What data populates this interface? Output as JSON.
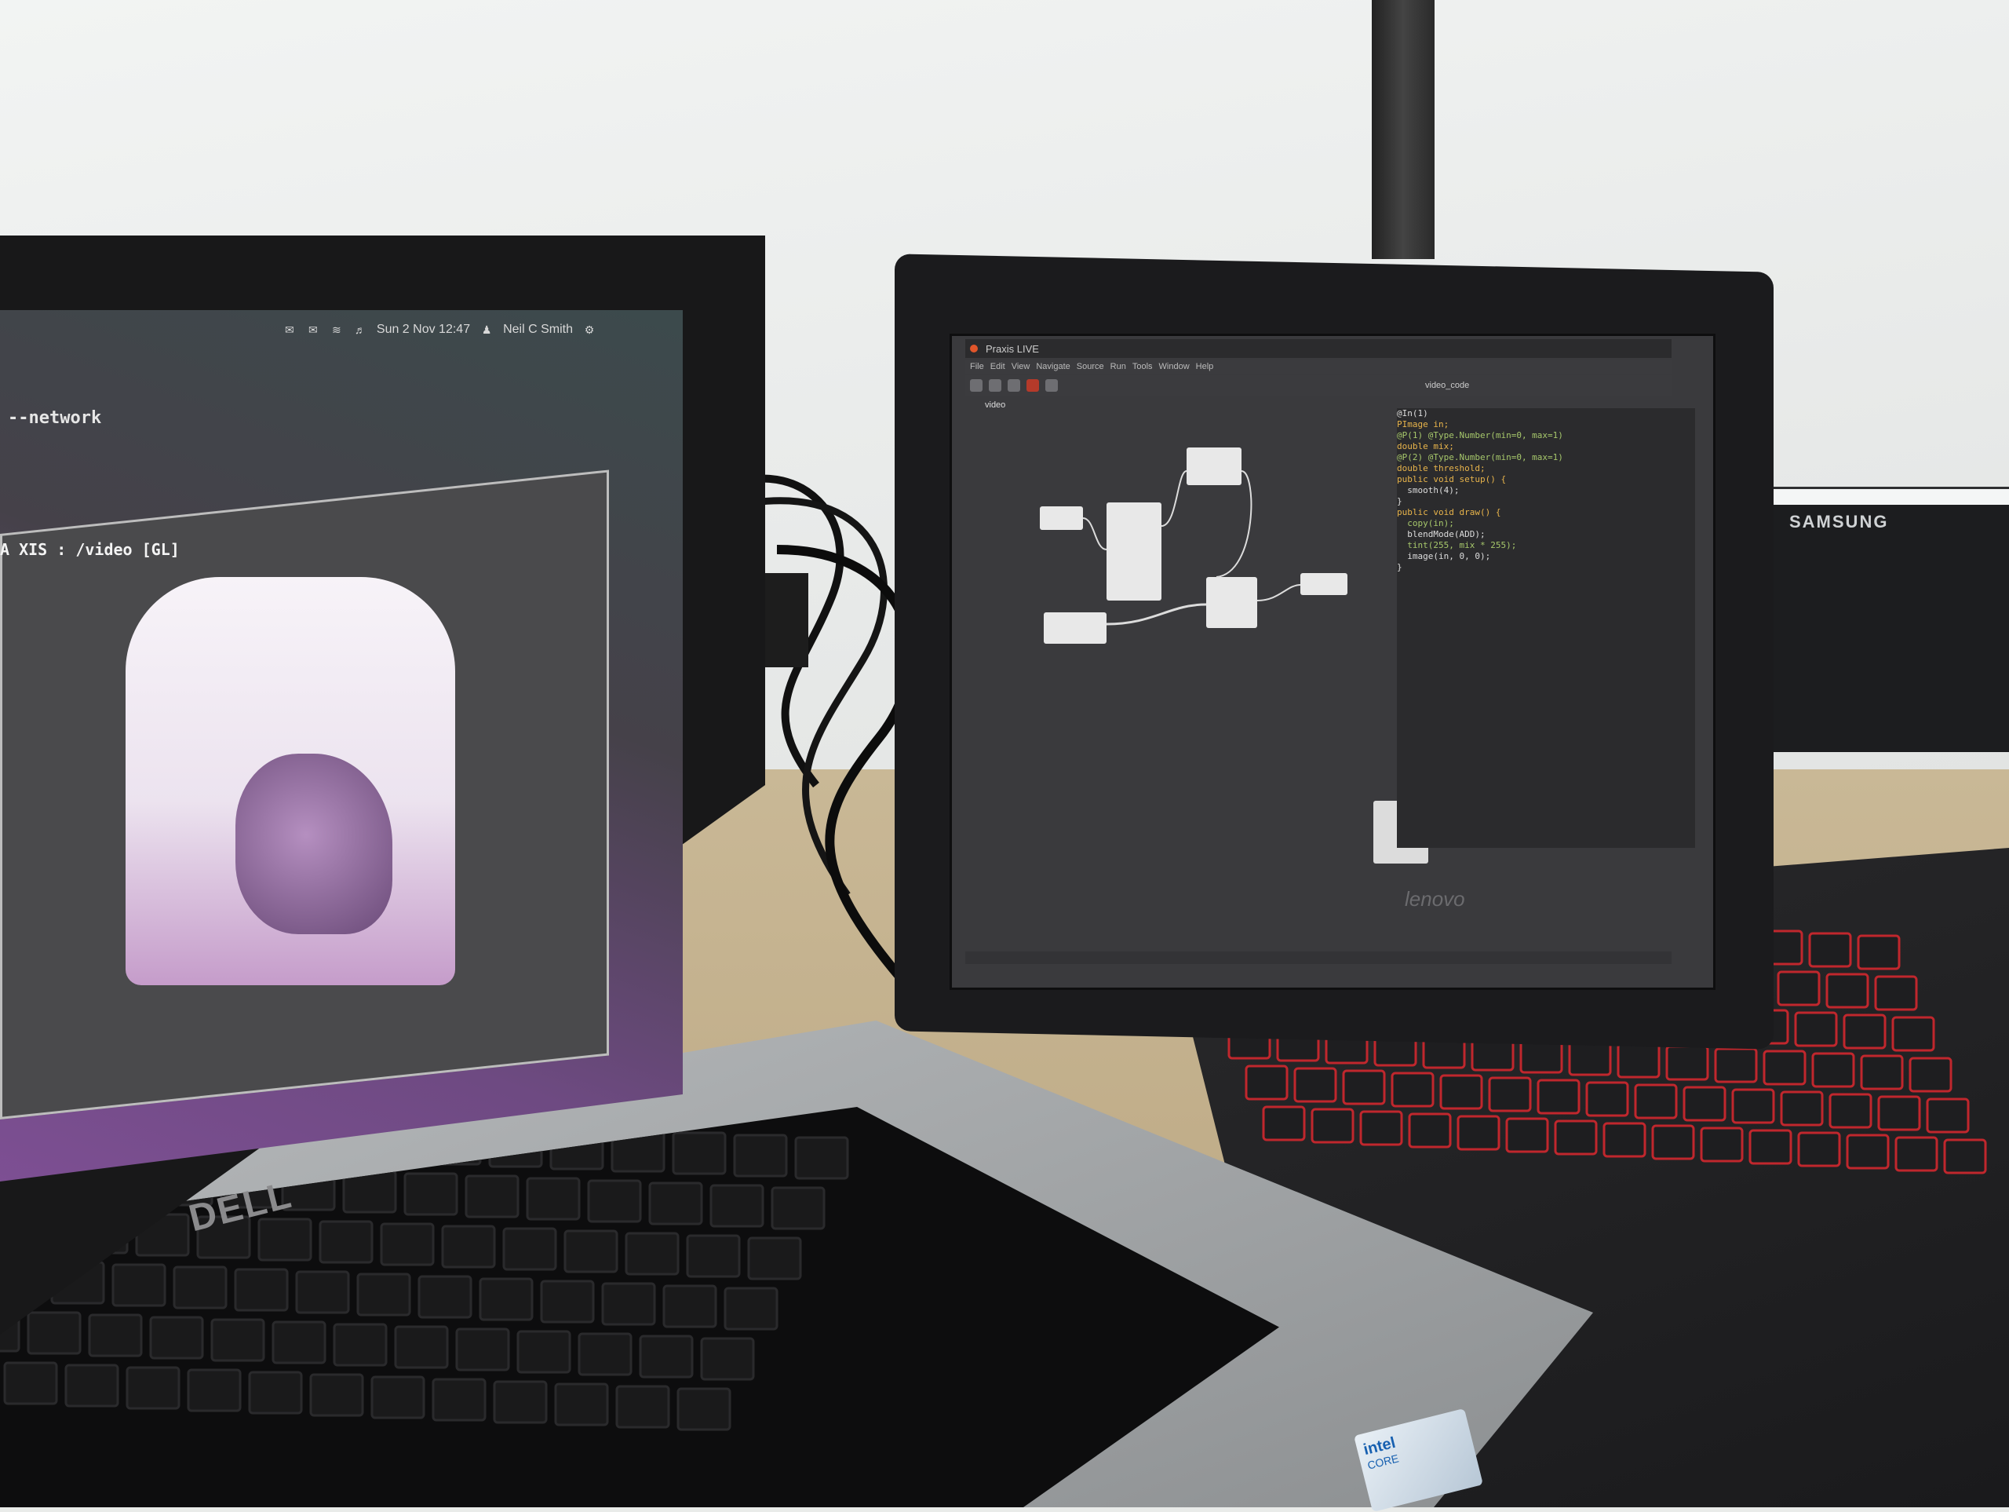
{
  "scene": {
    "left_laptop_brand": "DELL",
    "right_laptop_brand": "lenovo",
    "monitor_brand": "SAMSUNG",
    "intel_badge": {
      "brand": "intel",
      "line": "CORE"
    }
  },
  "ubuntu_panel": {
    "date_time": "Sun 2 Nov 12:47",
    "user": "Neil C Smith",
    "icons": [
      "mail-icon",
      "chat-icon",
      "network-icon",
      "volume-icon",
      "settings-icon"
    ]
  },
  "terminal": {
    "text": "--network"
  },
  "video_window": {
    "title": "A XIS : /video [GL]"
  },
  "ide": {
    "title": "Praxis LIVE",
    "menu": [
      "File",
      "Edit",
      "View",
      "Navigate",
      "Source",
      "Run",
      "Tools",
      "Window",
      "Help"
    ],
    "graph_tab": "video",
    "code_tab": "video_code",
    "code_lines": [
      [
        "cw",
        "@In(1)"
      ],
      [
        "ck",
        "PImage in;"
      ],
      [
        "cw",
        ""
      ],
      [
        "cg",
        "@P(1) @Type.Number(min=0, max=1)"
      ],
      [
        "ck",
        "double mix;"
      ],
      [
        "cg",
        "@P(2) @Type.Number(min=0, max=1)"
      ],
      [
        "ck",
        "double threshold;"
      ],
      [
        "cw",
        ""
      ],
      [
        "ck",
        "public void setup() {"
      ],
      [
        "cw",
        "  smooth(4);"
      ],
      [
        "cw",
        "}"
      ],
      [
        "cw",
        ""
      ],
      [
        "ck",
        "public void draw() {"
      ],
      [
        "cg",
        "  copy(in);"
      ],
      [
        "cw",
        "  blendMode(ADD);"
      ],
      [
        "cg",
        "  tint(255, mix * 255);"
      ],
      [
        "cw",
        "  image(in, 0, 0);"
      ],
      [
        "cw",
        "}"
      ]
    ]
  },
  "colors": {
    "ubuntu_purple": "#7d4f93",
    "lenovo_key_backlight": "#c0272d",
    "dell_key_accent": "#e0662a"
  }
}
